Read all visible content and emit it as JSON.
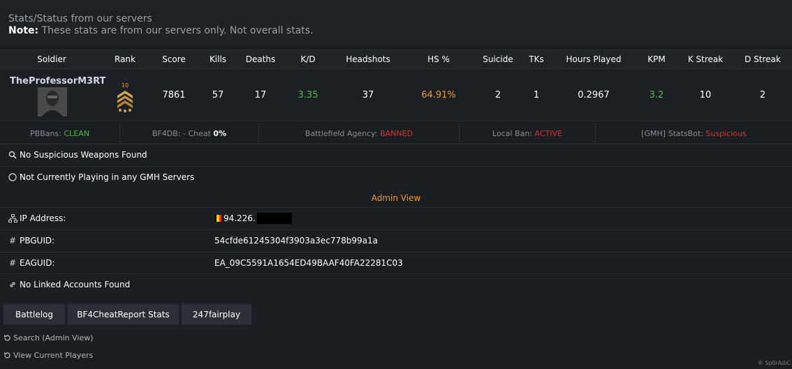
{
  "header": {
    "title": "Stats/Status from our servers",
    "note_label": "Note:",
    "note_text": " These stats are from our servers only. Not overall stats."
  },
  "stats": {
    "columns": [
      "Soldier",
      "Rank",
      "Score",
      "Kills",
      "Deaths",
      "K/D",
      "Headshots",
      "HS %",
      "Suicide",
      "TKs",
      "Hours Played",
      "KPM",
      "K Streak",
      "D Streak"
    ],
    "soldier_name": "TheProfessorM3RT",
    "rank": "10",
    "score": "7861",
    "kills": "57",
    "deaths": "17",
    "kd": "3.35",
    "headshots": "37",
    "hs_percent": "64.91%",
    "suicide": "2",
    "tks": "1",
    "hours_played": "0.2967",
    "kpm": "3.2",
    "k_streak": "10",
    "d_streak": "2"
  },
  "bans": {
    "pbbans_label": "PBBans: ",
    "pbbans_value": "CLEAN",
    "bf4db_label": "BF4DB: - Cheat ",
    "bf4db_value": "0%",
    "agency_label": "Battlefield Agency: ",
    "agency_value": "BANNED",
    "local_label": "Local Ban: ",
    "local_value": "ACTIVE",
    "statsbot_label": "[GMH] StatsBot: ",
    "statsbot_value": "Suspicious"
  },
  "status": {
    "weapons": "No Suspicious Weapons Found",
    "playing": "Not Currently Playing in any GMH Servers"
  },
  "admin": {
    "title": "Admin View",
    "ip_label": "IP Address:",
    "ip_value": "94.226.",
    "pbguid_label": "PBGUID:",
    "pbguid_value": "54cfde61245304f3903a3ec778b99a1a",
    "eaguid_label": "EAGUID:",
    "eaguid_value": "EA_09C5591A1654ED49BAAF40FA22281C03",
    "linked": "No Linked Accounts Found"
  },
  "buttons": {
    "battlelog": "Battlelog",
    "bf4cheatreport": "BF4CheatReport Stats",
    "fairplay": "247fairplay"
  },
  "links": {
    "search": "Search (Admin View)",
    "players": "View Current Players"
  },
  "watermark": "® Sp0rAdiC",
  "colors": {
    "accent_orange": "#f0962a",
    "good_green": "#3fbf3f",
    "bad_red": "#e0322f"
  }
}
